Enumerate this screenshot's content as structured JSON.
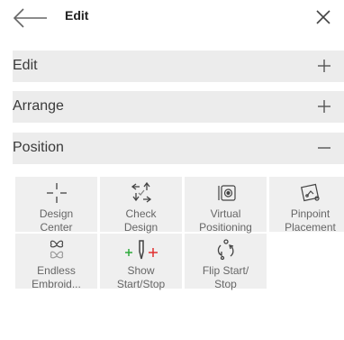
{
  "header": {
    "title": "Edit"
  },
  "sections": [
    {
      "label": "Edit",
      "sign": "+"
    },
    {
      "label": "Arrange",
      "sign": "+"
    },
    {
      "label": "Position",
      "sign": "−"
    }
  ],
  "tools": [
    {
      "line1": "Design",
      "line2": "Center",
      "icon": "design-center-icon"
    },
    {
      "line1": "Check",
      "line2": "Design",
      "icon": "check-design-icon"
    },
    {
      "line1": "Virtual",
      "line2": "Positioning",
      "icon": "virtual-positioning-icon"
    },
    {
      "line1": "Pinpoint",
      "line2": "Placement",
      "icon": "pinpoint-placement-icon"
    },
    {
      "line1": "Endless",
      "line2": "Embroid...",
      "icon": "endless-embroidery-icon"
    },
    {
      "line1": "Show",
      "line2": "Start/Stop",
      "icon": "show-start-stop-icon"
    },
    {
      "line1": "Flip Start/",
      "line2": "Stop",
      "icon": "flip-start-stop-icon"
    }
  ],
  "colors": {
    "start": "#2eaa3c",
    "stop": "#e03030",
    "section_bg": "#ececec",
    "tile_bg": "#efefef"
  }
}
